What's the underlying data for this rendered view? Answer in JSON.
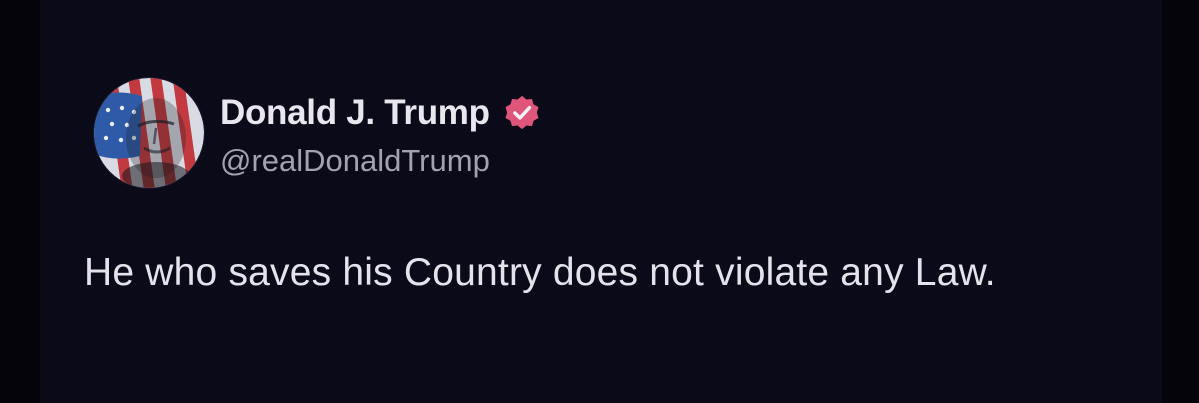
{
  "post": {
    "display_name": "Donald J. Trump",
    "handle": "@realDonaldTrump",
    "text": "He who saves his Country does not violate any Law.",
    "verified_badge_icon": "verified-badge-icon",
    "avatar_icon": "flag-portrait-avatar"
  },
  "colors": {
    "page_background": "#05040b",
    "card_background": "#0b0a18",
    "name_text": "#e8e7ee",
    "handle_text": "#a3a2b0",
    "body_text": "#e4e3ec",
    "badge": "#e0557a"
  }
}
